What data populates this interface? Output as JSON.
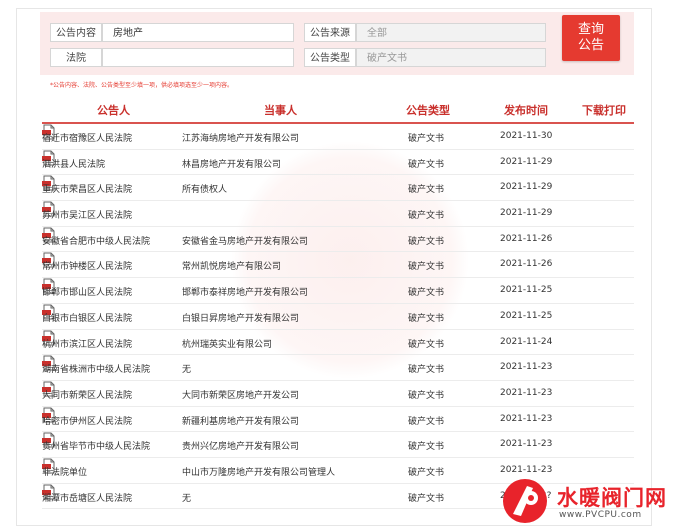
{
  "search": {
    "announcement_content_label": "公告内容",
    "announcement_content_value": "房地产",
    "court_label": "法院",
    "court_value": "",
    "source_label": "公告来源",
    "source_value": "全部",
    "type_label": "公告类型",
    "type_value": "破产文书",
    "query_button_line1": "查询",
    "query_button_line2": "公告",
    "hint": "*公告内容、法院、公告类型至少填一项，供必填项选至少一项内容。"
  },
  "table": {
    "headers": [
      "公告人",
      "当事人",
      "公告类型",
      "发布时间",
      "下载打印"
    ],
    "rows": [
      {
        "court": "宿迁市宿豫区人民法院",
        "party": "江苏海纳房地产开发有限公司",
        "type": "破产文书",
        "date": "2021-11-30"
      },
      {
        "court": "泗洪县人民法院",
        "party": "林昌房地产开发有限公司",
        "type": "破产文书",
        "date": "2021-11-29"
      },
      {
        "court": "重庆市荣昌区人民法院",
        "party": "所有债权人",
        "type": "破产文书",
        "date": "2021-11-29"
      },
      {
        "court": "苏州市吴江区人民法院",
        "party": "",
        "type": "破产文书",
        "date": "2021-11-29"
      },
      {
        "court": "安徽省合肥市中级人民法院",
        "party": "安徽省金马房地产开发有限公司",
        "type": "破产文书",
        "date": "2021-11-26"
      },
      {
        "court": "常州市钟楼区人民法院",
        "party": "常州凯悦房地产有限公司",
        "type": "破产文书",
        "date": "2021-11-26"
      },
      {
        "court": "邯郸市邯山区人民法院",
        "party": "邯郸市泰祥房地产开发有限公司",
        "type": "破产文书",
        "date": "2021-11-25"
      },
      {
        "court": "白银市白银区人民法院",
        "party": "白银日昇房地产开发有限公司",
        "type": "破产文书",
        "date": "2021-11-25"
      },
      {
        "court": "杭州市滨江区人民法院",
        "party": "杭州瑞英实业有限公司",
        "type": "破产文书",
        "date": "2021-11-24"
      },
      {
        "court": "湖南省株洲市中级人民法院",
        "party": "无",
        "type": "破产文书",
        "date": "2021-11-23"
      },
      {
        "court": "大同市新荣区人民法院",
        "party": "大同市新荣区房地产开发公司",
        "type": "破产文书",
        "date": "2021-11-23"
      },
      {
        "court": "哈密市伊州区人民法院",
        "party": "新疆利基房地产开发有限公司",
        "type": "破产文书",
        "date": "2021-11-23"
      },
      {
        "court": "贵州省毕节市中级人民法院",
        "party": "贵州兴亿房地产开发有限公司",
        "type": "破产文书",
        "date": "2021-11-23"
      },
      {
        "court": "非法院单位",
        "party": "中山市万隆房地产开发有限公司管理人",
        "type": "破产文书",
        "date": "2021-11-23"
      },
      {
        "court": "湘潭市岳塘区人民法院",
        "party": "无",
        "type": "破产文书",
        "date": "2021-11-2?"
      }
    ]
  },
  "brand": {
    "logo_text": "水暖阀门网",
    "logo_url": "www.PVCPU.com",
    "accent_color": "#e53a30"
  },
  "icons": {
    "download": "pdf-file-icon"
  }
}
